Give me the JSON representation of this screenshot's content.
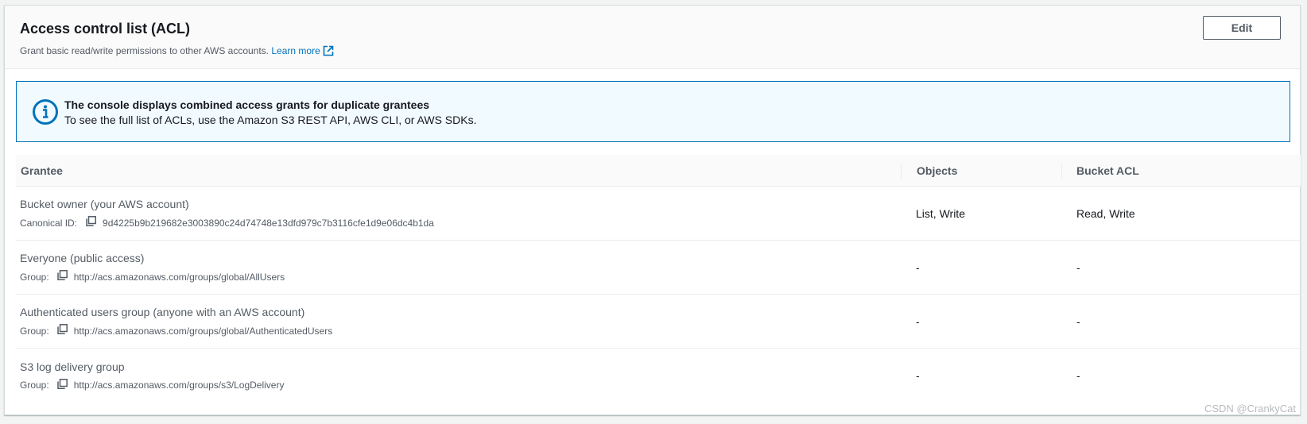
{
  "header": {
    "title": "Access control list (ACL)",
    "description": "Grant basic read/write permissions to other AWS accounts.",
    "learn_more": "Learn more",
    "edit_label": "Edit"
  },
  "alert": {
    "icon": "info-icon",
    "title": "The console displays combined access grants for duplicate grantees",
    "body": "To see the full list of ACLs, use the Amazon S3 REST API, AWS CLI, or AWS SDKs."
  },
  "table": {
    "columns": [
      "Grantee",
      "Objects",
      "Bucket ACL"
    ],
    "rows": [
      {
        "name": "Bucket owner (your AWS account)",
        "detail_label": "Canonical ID:",
        "detail_value": "9d4225b9b219682e3003890c24d74748e13dfd979c7b3116cfe1d9e06dc4b1da",
        "objects": "List, Write",
        "bucket_acl": "Read, Write"
      },
      {
        "name": "Everyone (public access)",
        "detail_label": "Group:",
        "detail_value": "http://acs.amazonaws.com/groups/global/AllUsers",
        "objects": "-",
        "bucket_acl": "-"
      },
      {
        "name": "Authenticated users group (anyone with an AWS account)",
        "detail_label": "Group:",
        "detail_value": "http://acs.amazonaws.com/groups/global/AuthenticatedUsers",
        "objects": "-",
        "bucket_acl": "-"
      },
      {
        "name": "S3 log delivery group",
        "detail_label": "Group:",
        "detail_value": "http://acs.amazonaws.com/groups/s3/LogDelivery",
        "objects": "-",
        "bucket_acl": "-"
      }
    ]
  },
  "watermark": "CSDN @CrankyCat",
  "colors": {
    "link": "#0073bb",
    "alert_border": "#0073bb",
    "alert_bg": "#f1faff",
    "text": "#16191f",
    "secondary_text": "#545b64"
  }
}
